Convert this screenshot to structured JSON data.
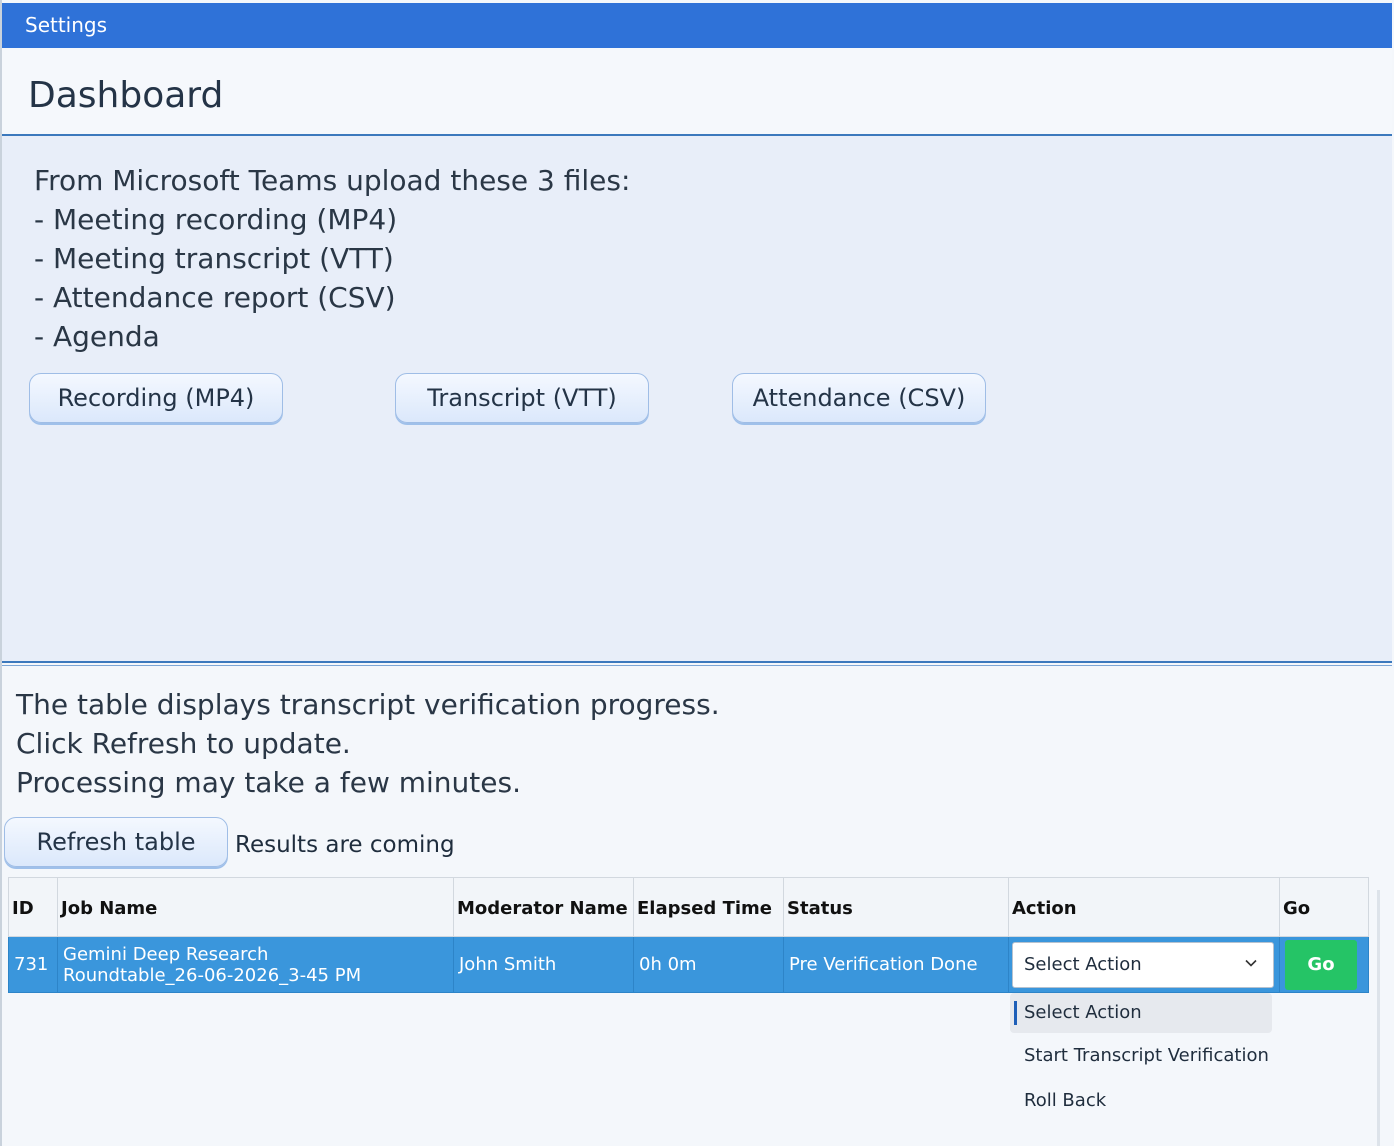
{
  "window": {
    "title": "Settings"
  },
  "page": {
    "title": "Dashboard"
  },
  "instructions": {
    "heading": "From Microsoft Teams upload these 3 files:",
    "items": [
      "- Meeting recording (MP4)",
      "- Meeting transcript (VTT)",
      "- Attendance report (CSV)",
      "- Agenda"
    ]
  },
  "upload_buttons": {
    "recording": "Recording (MP4)",
    "transcript": "Transcript (VTT)",
    "attendance": "Attendance (CSV)"
  },
  "table_info": {
    "line1": "The table displays transcript verification progress.",
    "line2": "Click Refresh to update.",
    "line3": "Processing may take a few minutes."
  },
  "refresh": {
    "label": "Refresh table",
    "status": "Results are coming"
  },
  "table": {
    "headers": [
      "ID",
      "Job Name",
      "Moderator Name",
      "Elapsed Time",
      "Status",
      "Action",
      "Go"
    ],
    "rows": [
      {
        "id": "731",
        "job_name_line1": "Gemini Deep Research",
        "job_name_line2": "Roundtable_26-06-2026_3-45 PM",
        "moderator": "John Smith",
        "elapsed": "0h 0m",
        "status": "Pre Verification Done",
        "action_selected": "Select Action",
        "go_label": "Go"
      }
    ]
  },
  "action_dropdown": {
    "options": [
      "Select Action",
      "Start Transcript Verification",
      "Roll Back"
    ]
  },
  "colors": {
    "titlebar": "#2f72d8",
    "row_selected": "#3a96dc",
    "go_button": "#25c466",
    "accent_line": "#3c79bd"
  },
  "icons": {
    "select_chevron": "chevron-down-icon"
  }
}
